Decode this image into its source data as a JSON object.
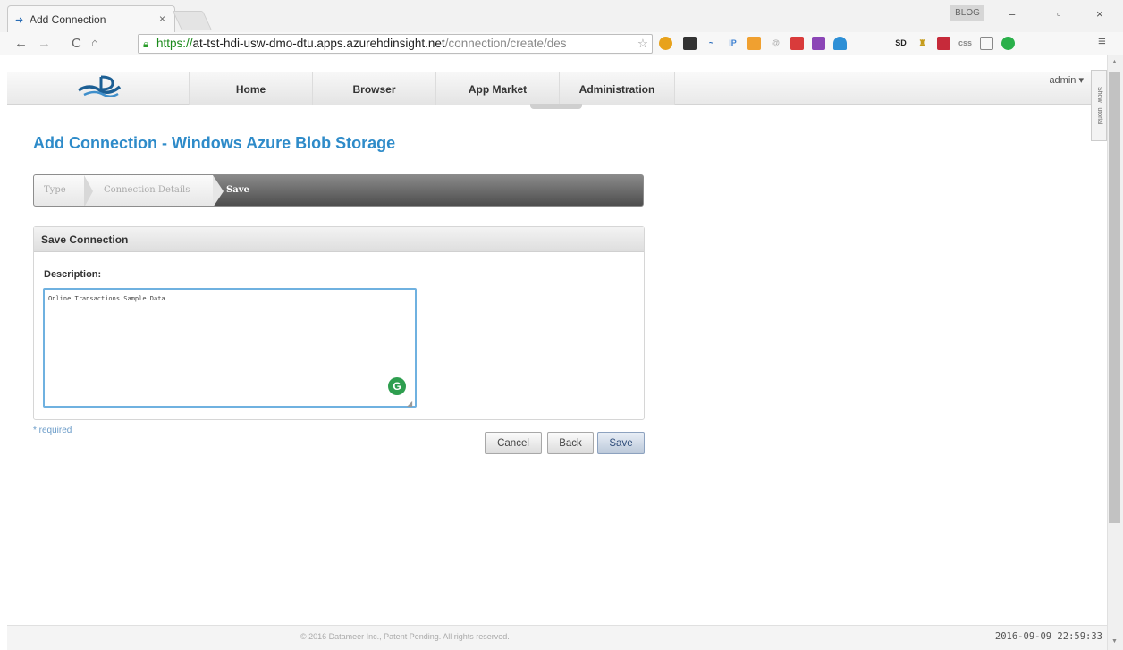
{
  "browser": {
    "tab_title": "Add Connection",
    "url_scheme": "https://",
    "url_host": "at-tst-hdi-usw-dmo-dtu.apps.azurehdinsight.net",
    "url_path": "/connection/create/des",
    "user_badge": "BLOG"
  },
  "app": {
    "nav": [
      "Home",
      "Browser",
      "App Market",
      "Administration"
    ],
    "admin_menu": "admin",
    "side_tab": "Show Tutorial"
  },
  "page": {
    "title": "Add Connection - Windows Azure Blob Storage",
    "steps": [
      "Type",
      "Connection Details",
      "Save"
    ],
    "active_step": "Save"
  },
  "panel": {
    "header": "Save Connection",
    "description_label": "Description:",
    "description_value": "Online Transactions Sample Data"
  },
  "form": {
    "required_note": "* required",
    "cancel_label": "Cancel",
    "back_label": "Back",
    "save_label": "Save"
  },
  "footer": {
    "copyright": "© 2016 Datameer Inc., Patent Pending. All rights reserved.",
    "timestamp": "2016-09-09 22:59:33"
  },
  "colors": {
    "title_blue": "#2e8bc9",
    "wizard_dark": "#4e4e4e",
    "focus_border": "#6fb1e0"
  }
}
